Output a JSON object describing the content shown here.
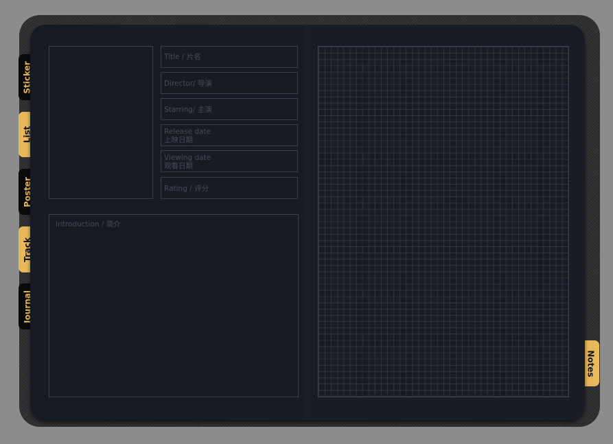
{
  "left_tabs": [
    {
      "label": "Sticker",
      "active": false
    },
    {
      "label": "List",
      "active": true
    },
    {
      "label": "Poster",
      "active": false
    },
    {
      "label": "Track",
      "active": true
    },
    {
      "label": "Journal",
      "active": false
    }
  ],
  "right_tab": {
    "label": "Notes"
  },
  "fields": {
    "title": "Title / 片名",
    "director": "Director/ 导演",
    "starring": "Starring/ 主演",
    "release_date": [
      "Release date",
      "上映日期"
    ],
    "viewing_date": [
      "Viewing date",
      "观看日期"
    ],
    "rating": "Rating / 评分",
    "introduction": "Introduction / 简介"
  },
  "colors": {
    "accent": "#e9b85c",
    "tab_dark": "#0b0b0d",
    "page": "#181c24",
    "cover": "#2b2b2d",
    "background": "#8c8c8c",
    "field_border": "#3b4050",
    "field_text": "#444a59"
  }
}
